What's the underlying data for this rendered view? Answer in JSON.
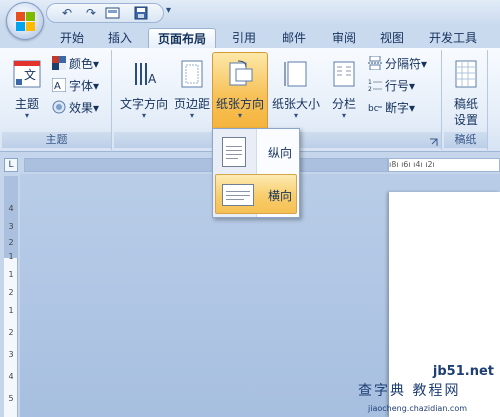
{
  "qat": {
    "undo": "↶",
    "redo": "↷",
    "more": "▾"
  },
  "tabs": [
    {
      "label": "开始"
    },
    {
      "label": "插入"
    },
    {
      "label": "页面布局"
    },
    {
      "label": "引用"
    },
    {
      "label": "邮件"
    },
    {
      "label": "审阅"
    },
    {
      "label": "视图"
    },
    {
      "label": "开发工具"
    }
  ],
  "ribbon": {
    "theme_group": {
      "label": "主题",
      "theme_button": "主题",
      "colors": "颜色",
      "fonts": "字体",
      "effects": "效果",
      "theme_icon_text": "文"
    },
    "page_setup_group": {
      "text_direction": "文字方向",
      "margins": "页边距",
      "orientation": "纸张方向",
      "size": "纸张大小",
      "columns": "分栏",
      "breaks": "分隔符",
      "line_numbers": "行号",
      "hyphenation": "断字"
    },
    "draft_group": {
      "label": "稿纸",
      "draft_button_line1": "稿纸",
      "draft_button_line2": "设置"
    },
    "dropdown_arrow": "▾"
  },
  "orientation_menu": {
    "portrait": "纵向",
    "landscape": "横向"
  },
  "ruler": {
    "corner": "L",
    "h_marks": "ı8ı  ı6ı  ı4ı  ı2ı",
    "v_marks": [
      "4",
      "3",
      "2",
      "1",
      "1",
      "2",
      "1",
      "2",
      "3",
      "4",
      "5"
    ]
  },
  "watermark": {
    "site": "jb51.net",
    "cn": "查字典 教程网",
    "url": "jiaocheng.chazidian.com"
  },
  "colors": {
    "ribbon_bg": "#e4edf8",
    "highlight": "#f7c25a",
    "text": "#15325d"
  }
}
